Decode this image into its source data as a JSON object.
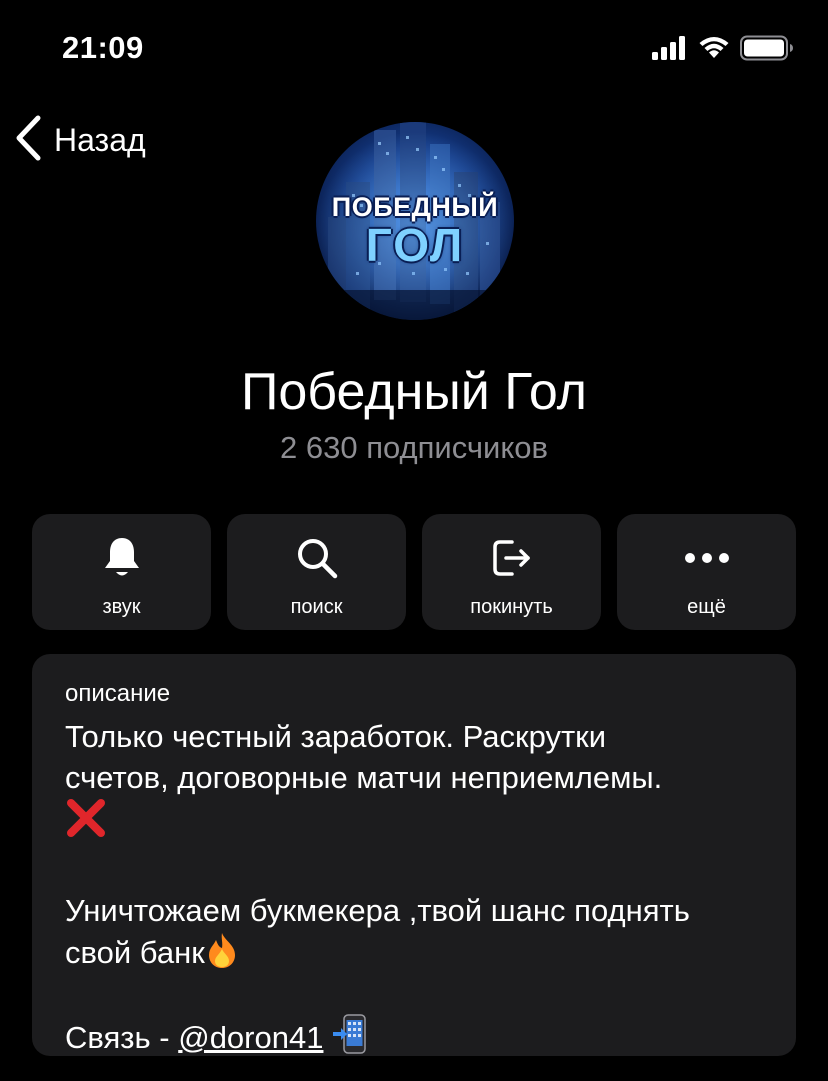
{
  "status_bar": {
    "time": "21:09"
  },
  "nav": {
    "back_label": "Назад"
  },
  "channel": {
    "avatar_line1": "ПОБЕДНЫЙ",
    "avatar_line2": "ГОЛ",
    "title": "Победный Гол",
    "subscribers": "2 630 подписчиков"
  },
  "actions": {
    "sound": "звук",
    "search": "поиск",
    "leave": "покинуть",
    "more": "ещё"
  },
  "description": {
    "heading": "описание",
    "line1": "Только честный заработок. Раскрутки",
    "line2": "счетов, договорные матчи неприемлемы.",
    "line3": "Уничтожаем букмекера ,твой шанс поднять",
    "line4": "свой банк",
    "contact_prefix": "Связь - ",
    "contact_link": "@doron41"
  },
  "colors": {
    "background": "#000000",
    "card": "#1c1c1e",
    "secondary_text": "#8e8e93",
    "red_x": "#e0262b",
    "fire": "#ff8a1d"
  }
}
